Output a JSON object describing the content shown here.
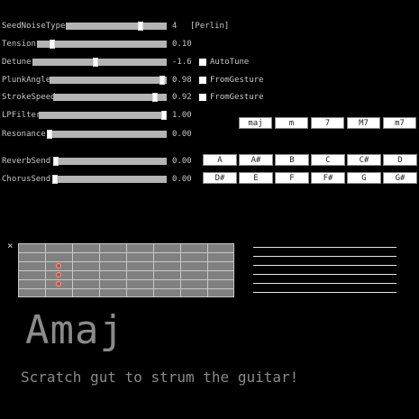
{
  "sliders": [
    {
      "label": "SeedNoiseType",
      "value": "4",
      "fraction": 0.75
    },
    {
      "label": "Tension",
      "value": "0.10",
      "fraction": 0.1
    },
    {
      "label": "Detune",
      "value": "-1.6",
      "fraction": 0.47
    },
    {
      "label": "PlunkAngle",
      "value": "0.98",
      "fraction": 0.98
    },
    {
      "label": "StrokeSpeed",
      "value": "0.92",
      "fraction": 0.92
    },
    {
      "label": "LPFilter",
      "value": "1.00",
      "fraction": 1.0
    },
    {
      "label": "Resonance",
      "value": "0.00",
      "fraction": 0.0
    },
    {
      "label": "ReverbSend",
      "value": "0.00",
      "fraction": 0.0
    },
    {
      "label": "ChorusSend",
      "value": "0.00",
      "fraction": 0.0
    }
  ],
  "noise_type_label": "[Perlin]",
  "toggles": {
    "autotune": "AutoTune",
    "plunk_from_gesture": "FromGesture",
    "stroke_from_gesture": "FromGesture"
  },
  "chord_types": [
    "maj",
    "m",
    "7",
    "M7",
    "m7"
  ],
  "roots_row1": [
    "A",
    "A#",
    "B",
    "C",
    "C#",
    "D"
  ],
  "roots_row2": [
    "D#",
    "E",
    "F",
    "F#",
    "G",
    "G#"
  ],
  "fretboard": {
    "muted_marker": "×"
  },
  "chord_display": "Amaj",
  "hint": "Scratch gut to strum the guitar!"
}
